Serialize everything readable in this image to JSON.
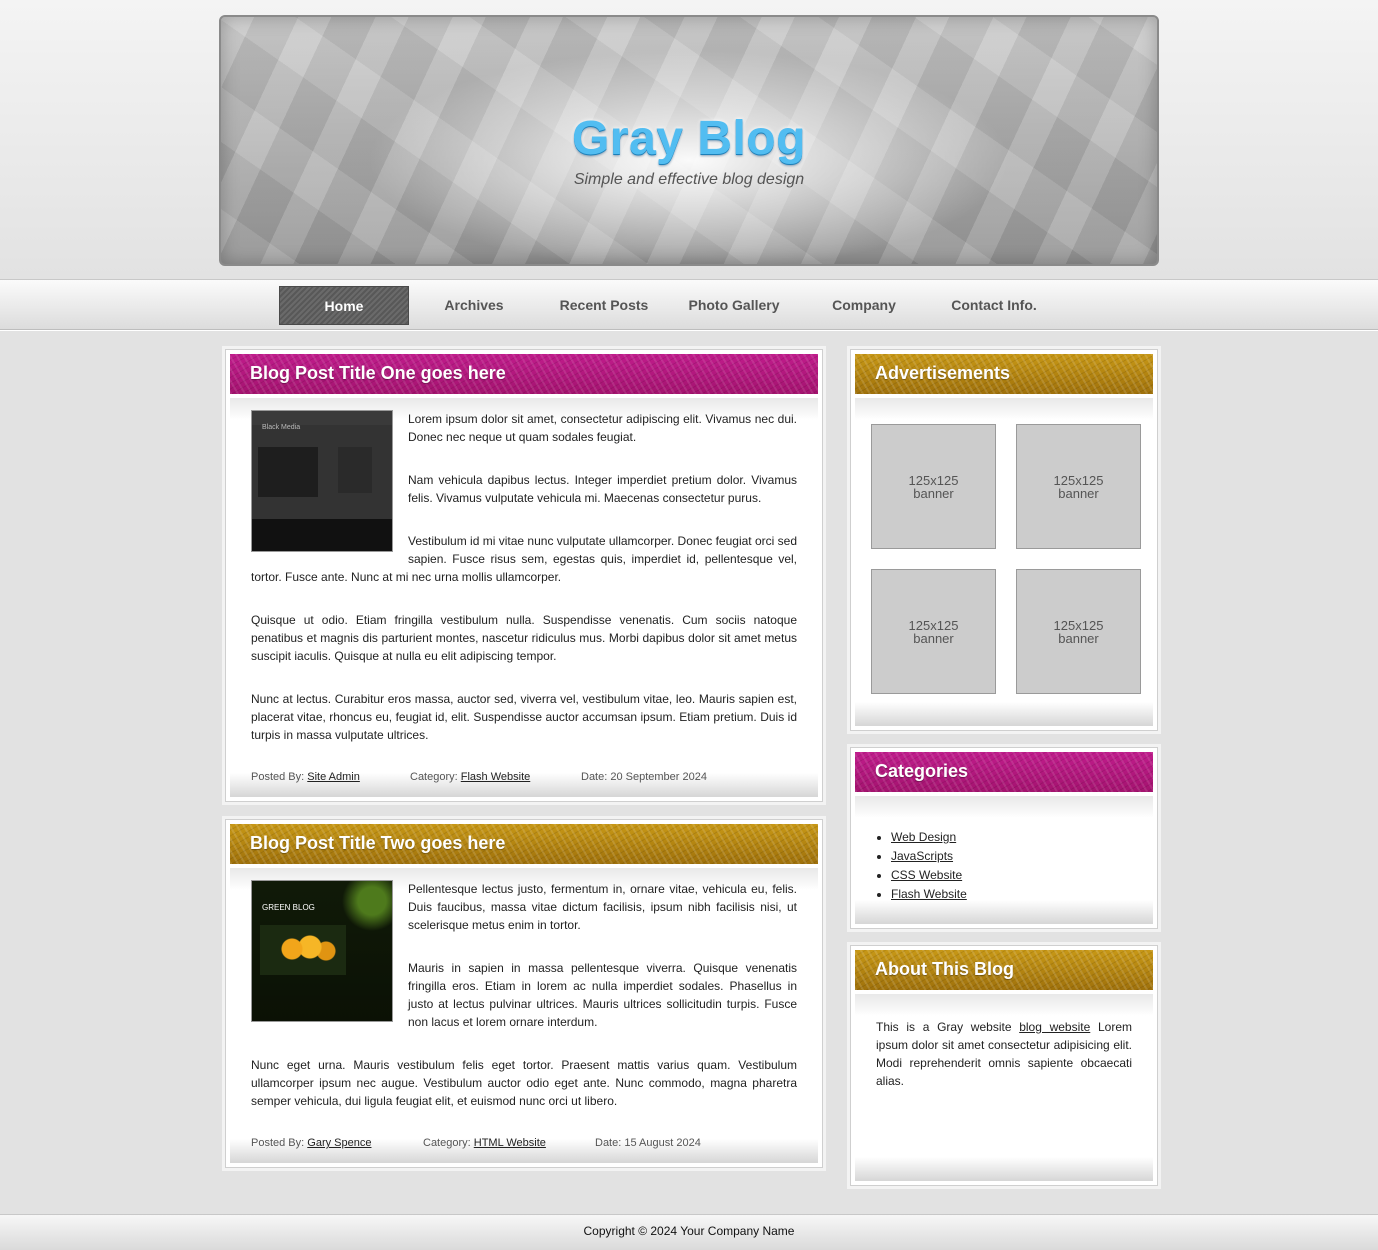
{
  "header": {
    "title": "Gray Blog",
    "tagline": "Simple and effective blog design"
  },
  "nav": {
    "items": [
      "Home",
      "Archives",
      "Recent Posts",
      "Photo Gallery",
      "Company",
      "Contact Info."
    ],
    "active": "Home"
  },
  "posts": [
    {
      "title": "Blog Post Title One goes here",
      "thumb_label": "Black Media",
      "paragraphs": [
        "Lorem ipsum dolor sit amet, consectetur adipiscing elit. Vivamus nec dui. Donec nec neque ut quam sodales feugiat.",
        "Nam vehicula dapibus lectus. Integer imperdiet pretium dolor. Vivamus felis. Vivamus vulputate vehicula mi. Maecenas consectetur purus.",
        "Vestibulum id mi vitae nunc vulputate ullamcorper. Donec feugiat orci sed sapien. Fusce risus sem, egestas quis, imperdiet id, pellentesque vel, tortor. Fusce ante. Nunc at mi nec urna mollis ullamcorper.",
        "Quisque ut odio. Etiam fringilla vestibulum nulla. Suspendisse venenatis. Cum sociis natoque penatibus et magnis dis parturient montes, nascetur ridiculus mus. Morbi dapibus dolor sit amet metus suscipit iaculis. Quisque at nulla eu elit adipiscing tempor.",
        "Nunc at lectus. Curabitur eros massa, auctor sed, viverra vel, vestibulum vitae, leo. Mauris sapien est, placerat vitae, rhoncus eu, feugiat id, elit. Suspendisse auctor accumsan ipsum. Etiam pretium. Duis id turpis in massa vulputate ultrices."
      ],
      "posted_by_label": "Posted By:",
      "author": "Site Admin",
      "category_label": "Category:",
      "category": "Flash Website",
      "date": "Date: 20 September 2024"
    },
    {
      "title": "Blog Post Title Two goes here",
      "thumb_label": "GREEN BLOG",
      "paragraphs": [
        "Pellentesque lectus justo, fermentum in, ornare vitae, vehicula eu, felis. Duis faucibus, massa vitae dictum facilisis, ipsum nibh facilisis nisi, ut scelerisque metus enim in tortor.",
        "Mauris in sapien in massa pellentesque viverra. Quisque venenatis fringilla eros. Etiam in lorem ac nulla imperdiet sodales. Phasellus in justo at lectus pulvinar ultrices. Mauris ultrices sollicitudin turpis. Fusce non lacus et lorem ornare interdum.",
        "Nunc eget urna. Mauris vestibulum felis eget tortor. Praesent mattis varius quam. Vestibulum ullamcorper ipsum nec augue. Vestibulum auctor odio eget ante. Nunc commodo, magna pharetra semper vehicula, dui ligula feugiat elit, et euismod nunc orci ut libero."
      ],
      "posted_by_label": "Posted By:",
      "author": "Gary Spence",
      "category_label": "Category:",
      "category": "HTML Website",
      "date": "Date: 15 August 2024"
    }
  ],
  "sidebar": {
    "ads_title": "Advertisements",
    "ad_line1": "125x125",
    "ad_line2": "banner",
    "categories_title": "Categories",
    "categories": [
      "Web Design",
      "JavaScripts",
      "CSS Website",
      "Flash Website"
    ],
    "about_title": "About This Blog",
    "about_before": "This is a Gray website ",
    "about_link": "blog website",
    "about_after": " Lorem ipsum dolor sit amet consectetur adipisicing elit. Modi reprehenderit omnis sapiente obcaecati alias."
  },
  "footer": {
    "copyright": "Copyright © 2024 Your Company Name"
  },
  "colors": {
    "magenta": "#b3177e",
    "gold": "#b4860f",
    "title_blue": "#52bdf1"
  }
}
